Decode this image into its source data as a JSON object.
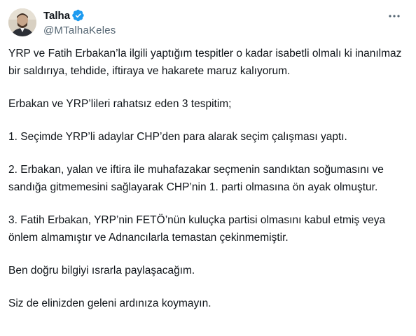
{
  "author": {
    "display_name": "Talha",
    "handle": "@MTalhaKeles",
    "verified_icon": "verified-badge-icon",
    "verified_color": "#1d9bf0"
  },
  "actions": {
    "more_icon": "more-horizontal-icon"
  },
  "tweet": {
    "paragraphs": [
      "YRP ve Fatih Erbakan’la ilgili yaptığım tespitler o kadar isabetli olmalı ki inanılmaz bir saldırıya, tehdide, iftiraya ve hakarete maruz kalıyorum.",
      "Erbakan ve YRP’lileri rahatsız eden 3 tespitim;",
      "1. Seçimde YRP’li adaylar CHP’den para alarak seçim çalışması yaptı.",
      "2. Erbakan, yalan ve iftira ile muhafazakar seçmenin sandıktan soğumasını ve sandığa gitmemesini sağlayarak CHP’nin 1. parti olmasına ön ayak olmuştur.",
      "3. Fatih Erbakan, YRP’nin FETÖ’nün kuluçka partisi olmasını kabul etmiş veya önlem almamıştır ve Adnancılarla temastan çekinmemiştir.",
      "Ben doğru bilgiyi ısrarla paylaşacağım.",
      "Siz de elinizden geleni ardınıza koymayın."
    ]
  }
}
